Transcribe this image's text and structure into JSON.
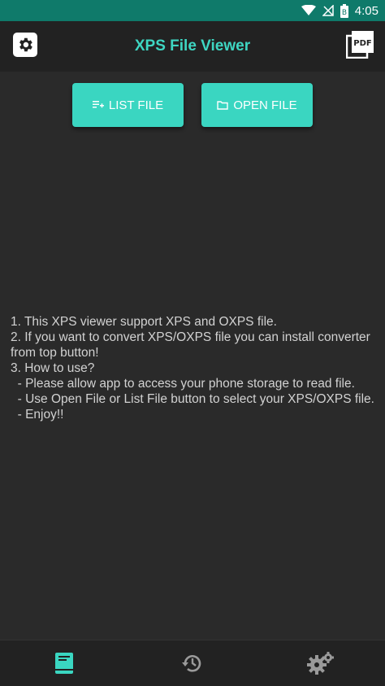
{
  "status_bar": {
    "time": "4:05",
    "battery_label": "B"
  },
  "app_bar": {
    "title": "XPS File Viewer",
    "pdf_label": "PDF"
  },
  "buttons": {
    "list_label": "LIST FILE",
    "open_label": "OPEN FILE"
  },
  "instructions": "1. This XPS viewer support XPS and OXPS file.\n2. If you want to convert XPS/OXPS file you can install converter from top button!\n3. How to use?\n  - Please allow app to access your phone storage to read file.\n  - Use Open File or List File button to select your XPS/OXPS file.\n  - Enjoy!!",
  "bottom_nav": {
    "items": [
      {
        "icon": "book-icon",
        "active": true
      },
      {
        "icon": "history-icon",
        "active": false
      },
      {
        "icon": "settings-gears-icon",
        "active": false
      }
    ]
  },
  "colors": {
    "accent": "#3ad6c1",
    "status_bar": "#0f7a6a",
    "background": "#2a2a2a",
    "app_bar": "#222222"
  }
}
